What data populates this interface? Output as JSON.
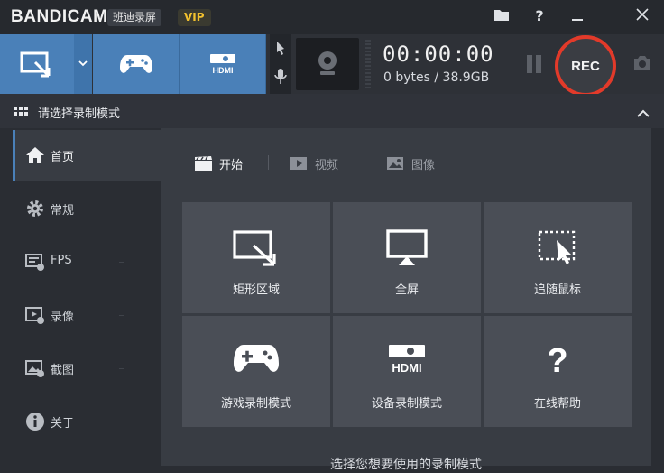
{
  "titlebar": {
    "logo": "BANDICAM",
    "brand_cn": "班迪录屏",
    "vip": "VIP",
    "icons": [
      "folder-icon",
      "help-icon",
      "minimize-icon",
      "close-icon"
    ]
  },
  "toolbar": {
    "modes": [
      "rectangle-mode-icon",
      "game-mode-icon",
      "hdmi-mode-icon"
    ],
    "timer": "00:00:00",
    "size_info": "0 bytes / 38.9GB",
    "rec_label": "REC"
  },
  "section": {
    "title": "请选择录制模式"
  },
  "sidebar": {
    "items": [
      {
        "label": "首页",
        "icon": "home-icon"
      },
      {
        "label": "常规",
        "icon": "gear-icon"
      },
      {
        "label": "FPS",
        "icon": "fps-icon"
      },
      {
        "label": "录像",
        "icon": "video-icon"
      },
      {
        "label": "截图",
        "icon": "image-icon"
      },
      {
        "label": "关于",
        "icon": "info-icon"
      }
    ]
  },
  "tabs": [
    {
      "label": "开始",
      "icon": "clapper-icon"
    },
    {
      "label": "视频",
      "icon": "play-icon"
    },
    {
      "label": "图像",
      "icon": "picture-icon"
    }
  ],
  "tiles": [
    {
      "label": "矩形区域",
      "icon": "rectangle-area-icon"
    },
    {
      "label": "全屏",
      "icon": "monitor-icon"
    },
    {
      "label": "追随鼠标",
      "icon": "follow-mouse-icon"
    },
    {
      "label": "游戏录制模式",
      "icon": "gamepad-icon"
    },
    {
      "label": "设备录制模式",
      "icon": "hdmi-icon"
    },
    {
      "label": "在线帮助",
      "icon": "question-icon"
    }
  ],
  "hint": "选择您想要使用的录制模式",
  "colors": {
    "accent": "#4a80b8",
    "rec": "#e23a2a",
    "vip": "#f2c12e"
  }
}
